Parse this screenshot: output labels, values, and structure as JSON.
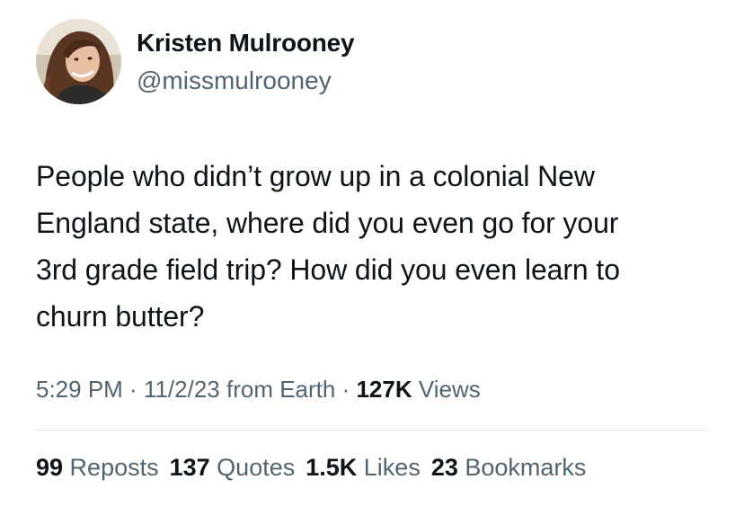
{
  "author": {
    "display_name": "Kristen Mulrooney",
    "handle": "@missmulrooney"
  },
  "tweet": {
    "lines": [
      "People who didn’t grow up in a colonial New",
      "England state, where did you even go for your",
      "3rd grade field trip? How did you even learn to",
      "churn butter?"
    ]
  },
  "meta": {
    "time": "5:29 PM",
    "sep1": " · ",
    "date": "11/2/23",
    "source": " from Earth",
    "sep2": " · ",
    "views_count": "127K",
    "views_label": " Views"
  },
  "stats": {
    "reposts_count": "99",
    "reposts_label": " Reposts",
    "quotes_count": "137",
    "quotes_label": " Quotes",
    "likes_count": "1.5K",
    "likes_label": " Likes",
    "bookmarks_count": "23",
    "bookmarks_label": " Bookmarks"
  },
  "colors": {
    "primary_text": "#0f1419",
    "secondary_text": "#536471",
    "divider": "#e1e6ea"
  }
}
